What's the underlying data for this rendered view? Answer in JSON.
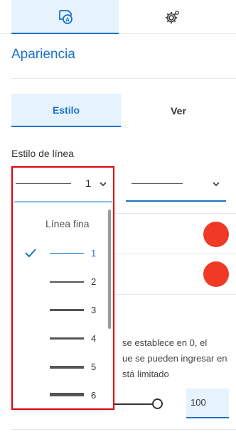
{
  "topbar": {
    "tabs": [
      {
        "icon": "style-appearance-icon",
        "active": true
      },
      {
        "icon": "gear-icon",
        "active": false
      }
    ]
  },
  "section": {
    "title": "Apariencia"
  },
  "segments": {
    "estilo": "Estilo",
    "ver": "Ver"
  },
  "line_style": {
    "label": "Estilo de línea",
    "width_value": "1"
  },
  "dropdown": {
    "header": "Línea fina",
    "items": [
      {
        "label": "1",
        "selected": true
      },
      {
        "label": "2",
        "selected": false
      },
      {
        "label": "3",
        "selected": false
      },
      {
        "label": "4",
        "selected": false
      },
      {
        "label": "5",
        "selected": false
      },
      {
        "label": "6",
        "selected": false
      }
    ]
  },
  "help_text": "se establece en 0, el ue se pueden ingresar en stá limitado",
  "help_lines": [
    "se establece en 0, el",
    "ue se pueden ingresar en",
    "stá limitado"
  ],
  "slider": {
    "value": "100"
  },
  "colors": {
    "accent": "#1a73c8",
    "accent_light": "#e6f2fc",
    "swatch": "#f03a26",
    "highlight_box": "#e0000a"
  }
}
